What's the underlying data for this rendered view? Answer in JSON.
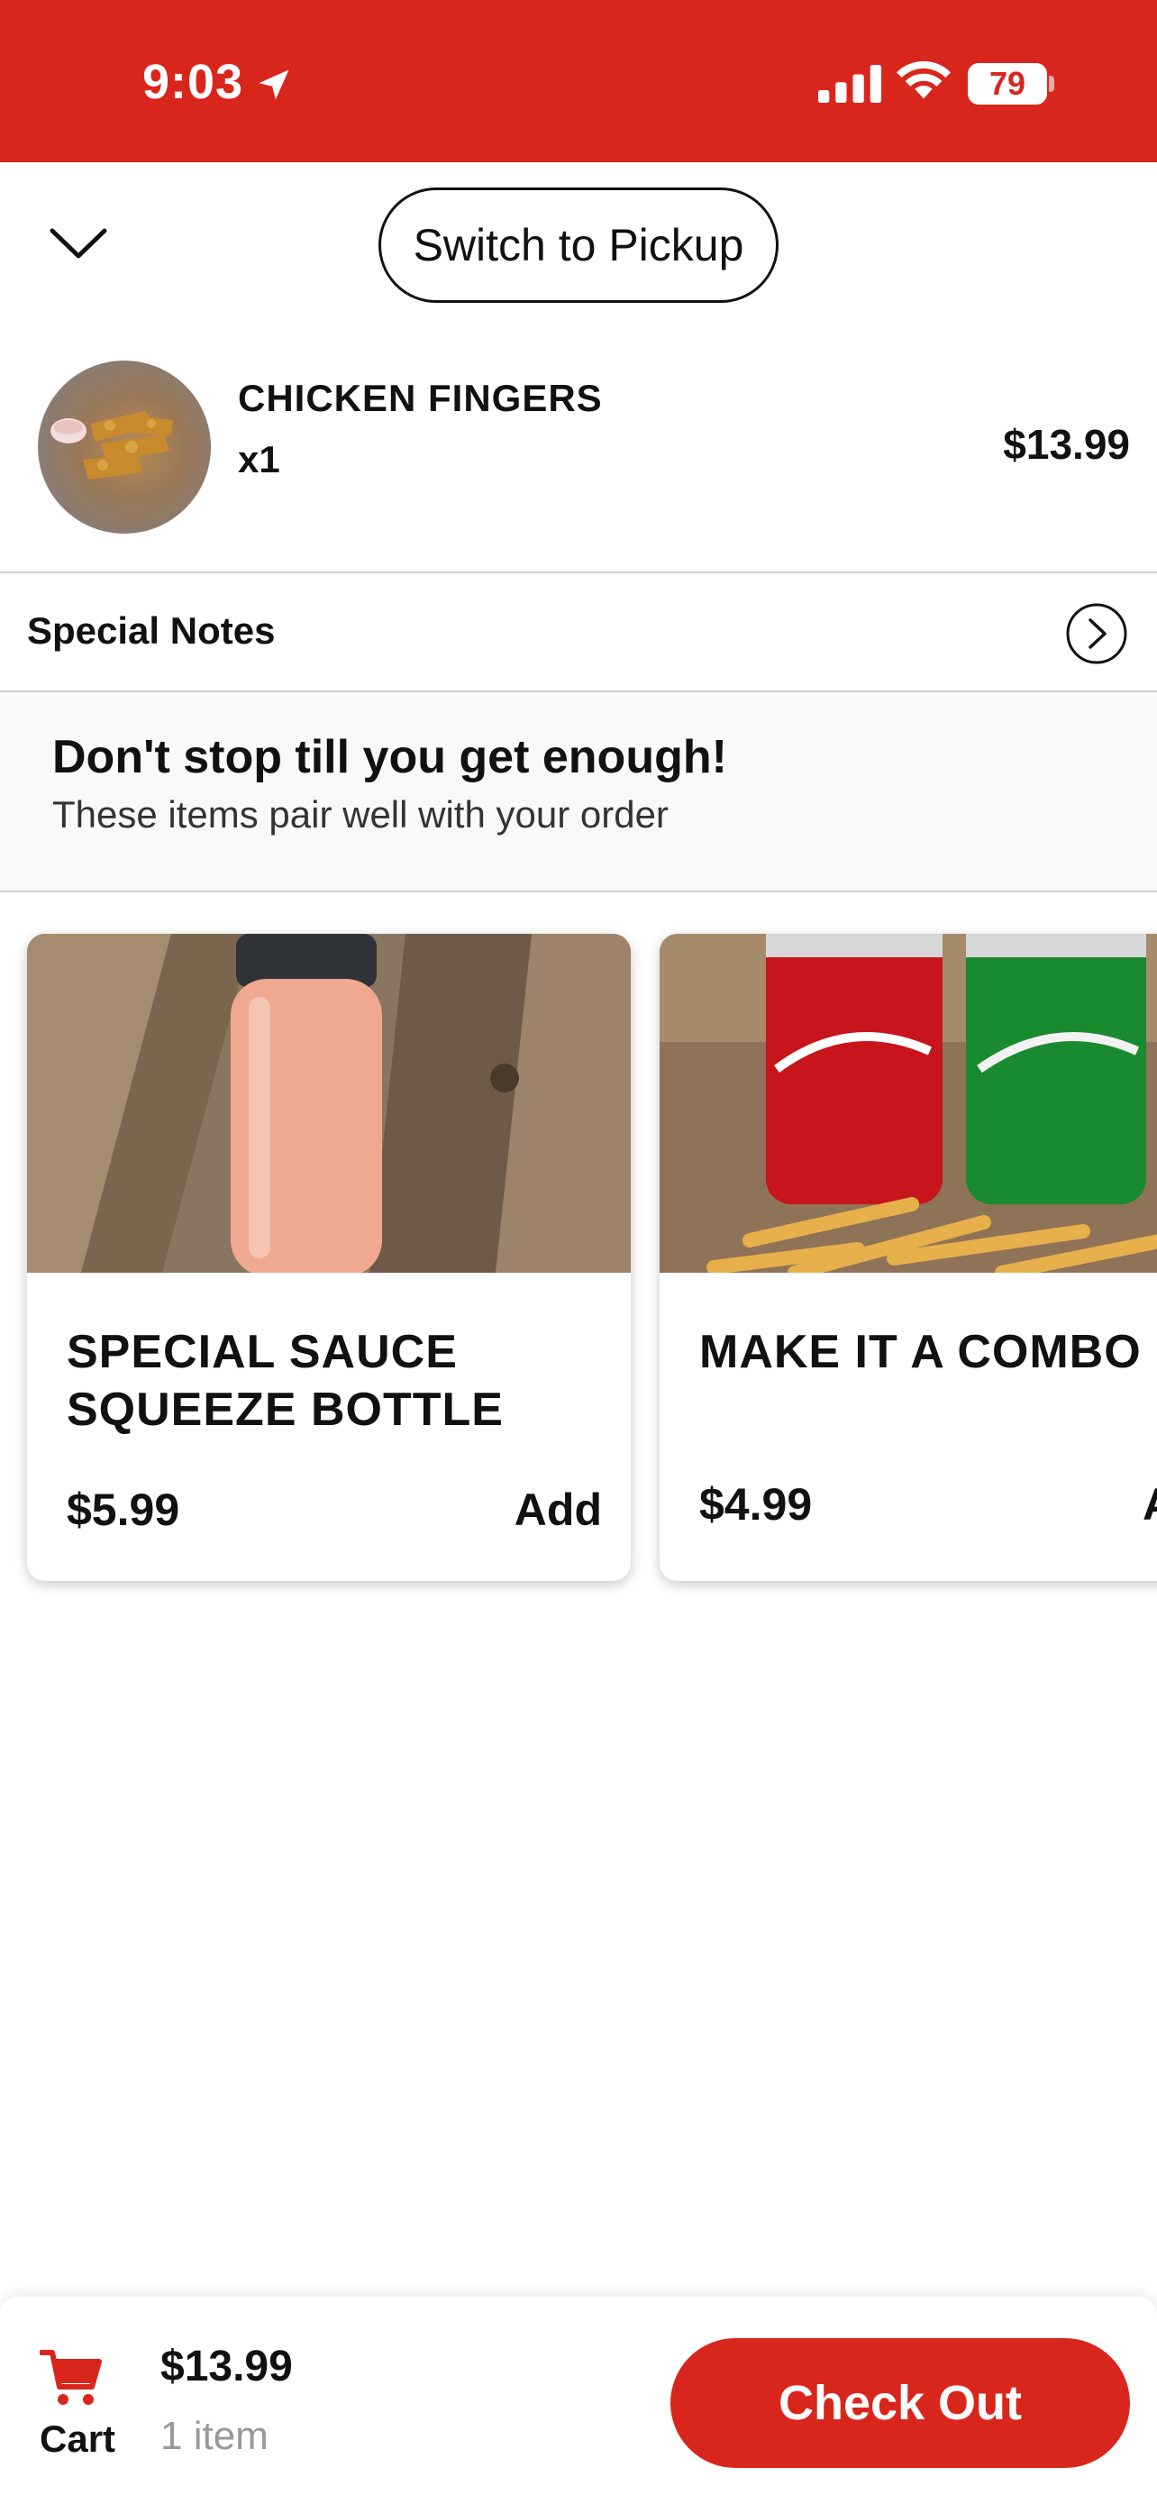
{
  "status_bar": {
    "time": "9:03",
    "battery": "79"
  },
  "header": {
    "switch_button_label": "Switch to Pickup"
  },
  "cart_item": {
    "name": "CHICKEN FINGERS",
    "quantity": "x1",
    "price": "$13.99"
  },
  "notes": {
    "label": "Special Notes"
  },
  "upsell": {
    "title": "Don't stop till you get enough!",
    "subtitle": "These items pair well with your order",
    "cards": [
      {
        "name_line1": "SPECIAL SAUCE",
        "name_line2": "SQUEEZE BOTTLE",
        "price": "$5.99",
        "add_label": "Add"
      },
      {
        "name_line1": "MAKE IT A COMBO",
        "name_line2": "",
        "price": "$4.99",
        "add_label": "Add"
      }
    ]
  },
  "bottom_bar": {
    "cart_label": "Cart",
    "total": "$13.99",
    "item_count": "1 item",
    "checkout_label": "Check Out"
  },
  "colors": {
    "brand_red": "#d9261c"
  },
  "icons": [
    "location-arrow-icon",
    "signal-icon",
    "wifi-icon",
    "battery-icon",
    "chevron-down-icon",
    "chevron-right-icon",
    "cart-icon"
  ]
}
